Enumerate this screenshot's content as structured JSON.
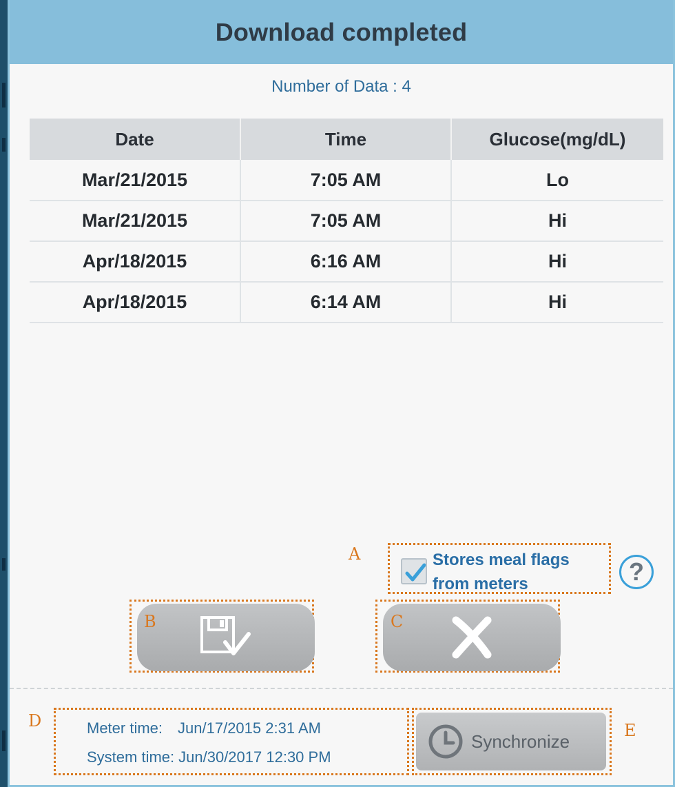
{
  "dialog": {
    "title": "Download completed",
    "count_text": "Number of Data : 4"
  },
  "table": {
    "headers": [
      "Date",
      "Time",
      "Glucose(mg/dL)"
    ],
    "rows": [
      [
        "Mar/21/2015",
        "7:05 AM",
        "Lo"
      ],
      [
        "Mar/21/2015",
        "7:05 AM",
        "Hi"
      ],
      [
        "Apr/18/2015",
        "6:16 AM",
        "Hi"
      ],
      [
        "Apr/18/2015",
        "6:14 AM",
        "Hi"
      ]
    ]
  },
  "meal_flags": {
    "label_line1": "Stores meal flags",
    "label_line2": "from meters",
    "checked": true
  },
  "help": {
    "symbol": "?",
    "icon": "help-icon"
  },
  "buttons": {
    "save_icon": "save-check-icon",
    "cancel_icon": "close-icon",
    "sync_label": "Synchronize",
    "sync_icon": "clock-icon"
  },
  "times": {
    "meter_label": "Meter time:",
    "meter_value": "Jun/17/2015 2:31 AM",
    "system_label": "System time:",
    "system_value": "Jun/30/2017 12:30 PM"
  },
  "annotations": {
    "a": "A",
    "b": "B",
    "c": "C",
    "d": "D",
    "e": "E"
  },
  "colors": {
    "title_bar": "#86bedb",
    "accent_text": "#2f6d9b",
    "annotation": "#d9781f",
    "check": "#3aa0d9"
  }
}
